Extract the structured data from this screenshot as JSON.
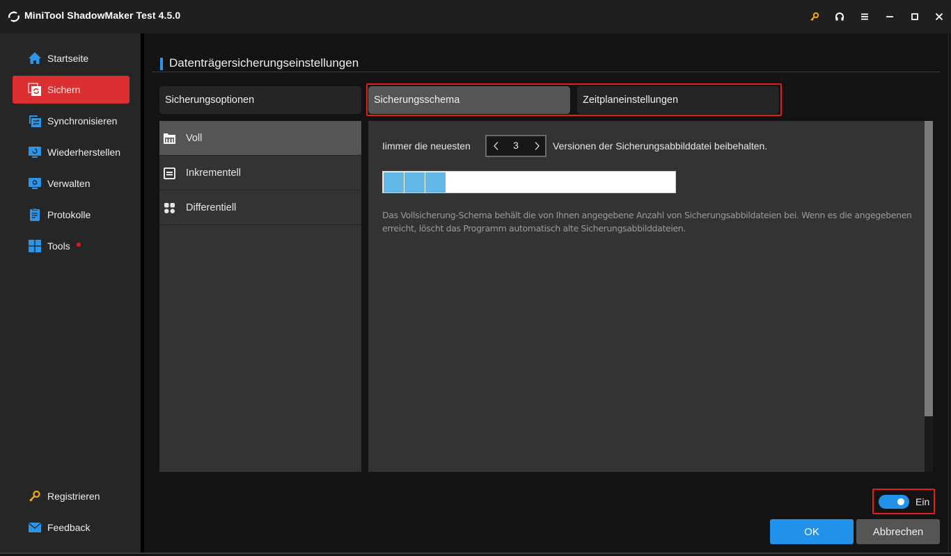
{
  "window": {
    "title": "MiniTool ShadowMaker Test 4.5.0",
    "controls": [
      {
        "name": "register-key-icon",
        "color": "#f0a81c"
      },
      {
        "name": "headset-icon"
      },
      {
        "name": "menu-icon"
      },
      {
        "name": "minimize-icon"
      },
      {
        "name": "maximize-icon"
      },
      {
        "name": "close-icon"
      }
    ]
  },
  "sidebar": {
    "items": [
      {
        "label": "Startseite",
        "icon": "home-icon",
        "active": false
      },
      {
        "label": "Sichern",
        "icon": "backup-icon",
        "active": true
      },
      {
        "label": "Synchronisieren",
        "icon": "sync-icon",
        "active": false
      },
      {
        "label": "Wiederherstellen",
        "icon": "restore-icon",
        "active": false
      },
      {
        "label": "Verwalten",
        "icon": "manage-icon",
        "active": false
      },
      {
        "label": "Protokolle",
        "icon": "logs-icon",
        "active": false
      },
      {
        "label": "Tools",
        "icon": "tools-icon",
        "active": false,
        "badge_dot": true
      }
    ],
    "bottom_items": [
      {
        "label": "Registrieren",
        "icon": "key-icon"
      },
      {
        "label": "Feedback",
        "icon": "mail-icon"
      }
    ]
  },
  "main": {
    "section_title": "Datenträgersicherungseinstellungen",
    "tabs": [
      {
        "label": "Sicherungsoptionen",
        "active": false
      },
      {
        "label": "Sicherungsschema",
        "active": true
      },
      {
        "label": "Zeitplaneinstellungen",
        "active": false
      }
    ],
    "schemes": [
      {
        "label": "Voll",
        "icon": "full-backup-icon",
        "active": true
      },
      {
        "label": "Inkrementell",
        "icon": "incremental-icon",
        "active": false
      },
      {
        "label": "Differentiell",
        "icon": "differential-icon",
        "active": false
      }
    ],
    "retention": {
      "prefix": "Iimmer die neuesten",
      "value": "3",
      "suffix": "Versionen der Sicherungsabbilddatei beibehalten.",
      "visualized_versions": 3
    },
    "description_line1": "Das Vollsicherung-Schema behält die von Ihnen angegebene Anzahl von Sicherungsabbildateien bei. Wenn es die angegebenen",
    "description_line2": "erreicht, löscht das Programm automatisch alte Sicherungsabbilddateien."
  },
  "footer": {
    "scheme_toggle": {
      "label": "Ein",
      "on": true
    },
    "ok_label": "OK",
    "cancel_label": "Abbrechen"
  },
  "colors": {
    "accent": "#2191ea",
    "active_nav": "#dc2f32",
    "highlight": "#e81b1b",
    "version_fill": "#62b8e6"
  }
}
